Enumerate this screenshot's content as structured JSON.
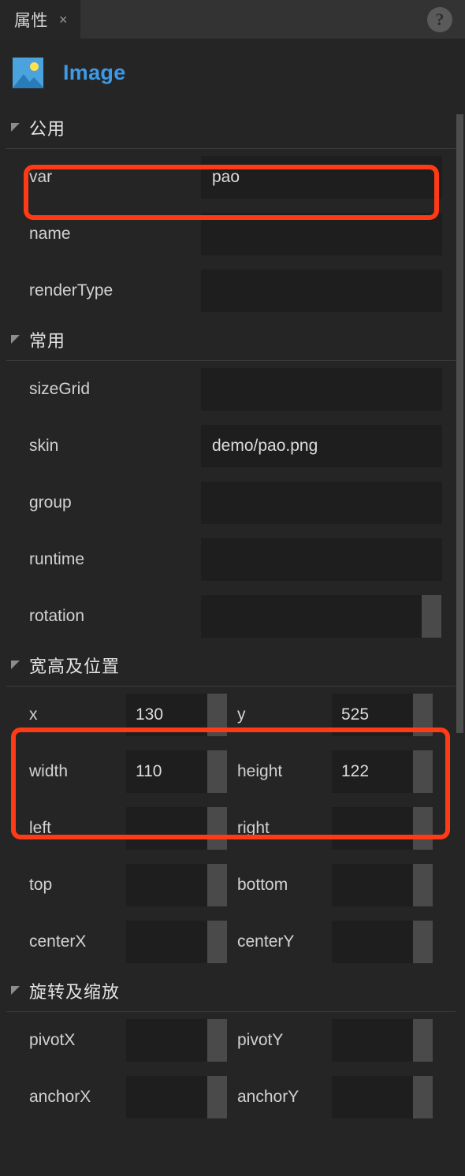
{
  "tab": {
    "label": "属性",
    "close": "×",
    "help": "?"
  },
  "header": {
    "icon": "image-icon",
    "title": "Image"
  },
  "sections": [
    {
      "name": "公用",
      "rows": [
        {
          "label": "var",
          "value": "pao",
          "kind": "text"
        },
        {
          "label": "name",
          "value": "",
          "kind": "text"
        },
        {
          "label": "renderType",
          "value": "",
          "kind": "select"
        }
      ]
    },
    {
      "name": "常用",
      "rows": [
        {
          "label": "sizeGrid",
          "value": "",
          "kind": "badge",
          "badge": "grid",
          "badge_color": "#f5a03c"
        },
        {
          "label": "skin",
          "value": "demo/pao.png",
          "kind": "badge",
          "badge": "skin",
          "badge_color": "#d3d44b"
        },
        {
          "label": "group",
          "value": "",
          "kind": "text"
        },
        {
          "label": "runtime",
          "value": "",
          "kind": "text"
        },
        {
          "label": "rotation",
          "value": "",
          "kind": "stepper"
        }
      ]
    },
    {
      "name": "宽高及位置",
      "pairs": [
        {
          "left_label": "x",
          "left_value": "130",
          "right_label": "y",
          "right_value": "525"
        },
        {
          "left_label": "width",
          "left_value": "110",
          "right_label": "height",
          "right_value": "122"
        },
        {
          "left_label": "left",
          "left_value": "",
          "right_label": "right",
          "right_value": ""
        },
        {
          "left_label": "top",
          "left_value": "",
          "right_label": "bottom",
          "right_value": ""
        },
        {
          "left_label": "centerX",
          "left_value": "",
          "right_label": "centerY",
          "right_value": ""
        }
      ]
    },
    {
      "name": "旋转及缩放",
      "pairs": [
        {
          "left_label": "pivotX",
          "left_value": "",
          "right_label": "pivotY",
          "right_value": ""
        },
        {
          "left_label": "anchorX",
          "left_value": "",
          "right_label": "anchorY",
          "right_value": ""
        }
      ]
    }
  ],
  "annotations": {
    "highlight_color": "#ff3a17",
    "boxes": [
      {
        "name": "var-row-highlight"
      },
      {
        "name": "position-size-highlight"
      }
    ]
  }
}
